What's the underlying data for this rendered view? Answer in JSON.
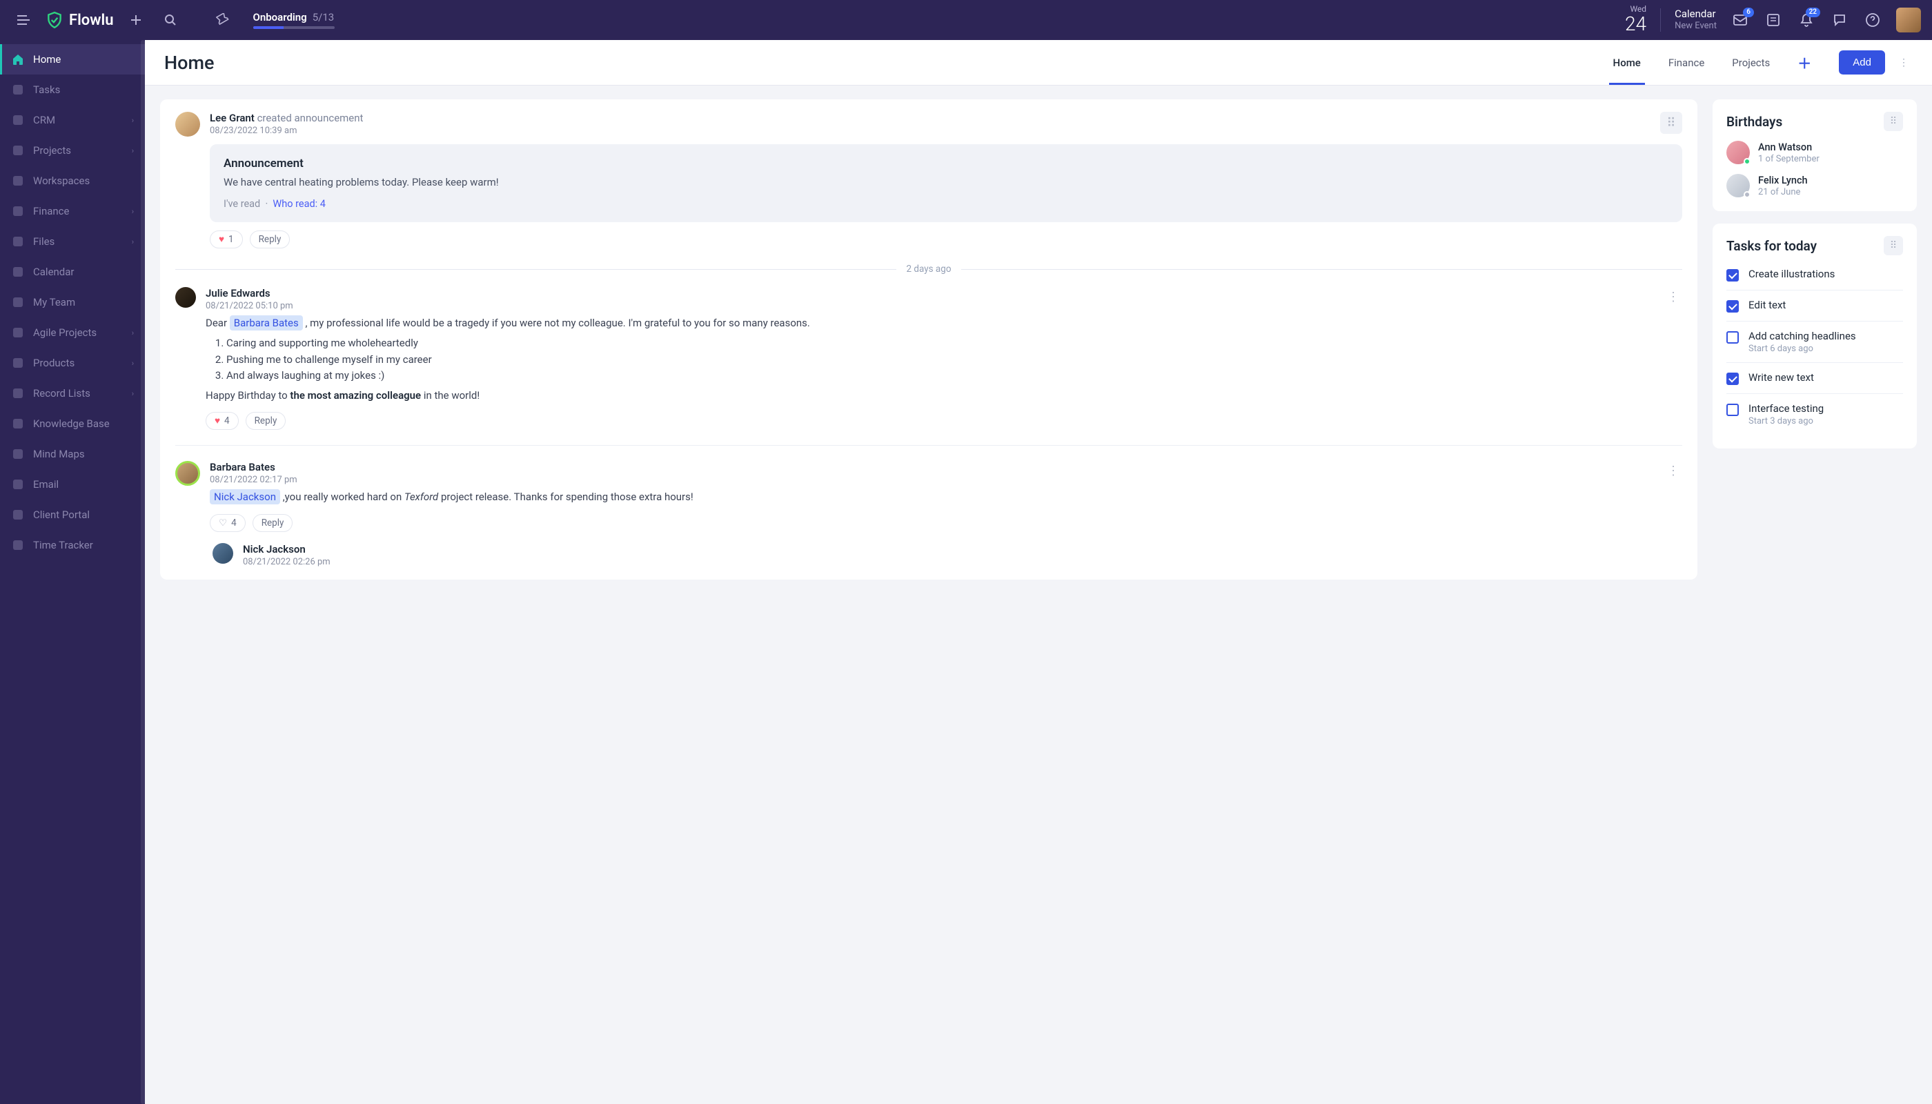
{
  "brand": "Flowlu",
  "onboarding": {
    "label": "Onboarding",
    "count": "5/13",
    "progress_pct": 38
  },
  "topbar": {
    "date": {
      "dow": "Wed",
      "day": "24"
    },
    "calendar": {
      "title": "Calendar",
      "sub": "New Event"
    },
    "badges": {
      "inbox": "6",
      "bell": "22"
    }
  },
  "sidebar": {
    "items": [
      {
        "label": "Home",
        "icon": "home",
        "active": true
      },
      {
        "label": "Tasks",
        "icon": "check"
      },
      {
        "label": "CRM",
        "icon": "funnel",
        "chev": true
      },
      {
        "label": "Projects",
        "icon": "briefcase",
        "chev": true
      },
      {
        "label": "Workspaces",
        "icon": "grid"
      },
      {
        "label": "Finance",
        "icon": "graph",
        "chev": true
      },
      {
        "label": "Files",
        "icon": "folder",
        "chev": true
      },
      {
        "label": "Calendar",
        "icon": "calendar"
      },
      {
        "label": "My Team",
        "icon": "users"
      },
      {
        "label": "Agile Projects",
        "icon": "agile",
        "chev": true
      },
      {
        "label": "Products",
        "icon": "box",
        "chev": true
      },
      {
        "label": "Record Lists",
        "icon": "list",
        "chev": true
      },
      {
        "label": "Knowledge Base",
        "icon": "book"
      },
      {
        "label": "Mind Maps",
        "icon": "mindmap"
      },
      {
        "label": "Email",
        "icon": "mail"
      },
      {
        "label": "Client Portal",
        "icon": "portal"
      },
      {
        "label": "Time Tracker",
        "icon": "clock"
      }
    ]
  },
  "page": {
    "title": "Home",
    "tabs": [
      "Home",
      "Finance",
      "Projects"
    ],
    "add_label": "Add"
  },
  "feed": {
    "divider": "2 days ago",
    "posts": [
      {
        "author": "Lee Grant",
        "action": "created announcement",
        "time": "08/23/2022 10:39 am",
        "announcement": {
          "title": "Announcement",
          "body": "We have central heating problems today. Please keep warm!",
          "read_label": "I've read",
          "who_read": "Who read: 4"
        },
        "likes": "1",
        "reply": "Reply"
      },
      {
        "author": "Julie Edwards",
        "time": "08/21/2022 05:10 pm",
        "rich": {
          "pre": "Dear ",
          "mention": "Barbara Bates",
          "post": " , my professional life would be a tragedy if you were not my colleague. I'm grateful to you for so many reasons.",
          "list": [
            "Caring and supporting me wholeheartedly",
            "Pushing me to challenge myself in my career",
            "And always laughing at my jokes :)"
          ],
          "closing_pre": "Happy Birthday to ",
          "closing_bold": "the most amazing colleague",
          "closing_post": " in the world!"
        },
        "likes": "4",
        "reply": "Reply"
      },
      {
        "author": "Barbara Bates",
        "time": "08/21/2022 02:17 pm",
        "rich2": {
          "mention": "Nick Jackson",
          "post_a": " ,you really worked hard on ",
          "italic": "Texford",
          "post_b": " project release. Thanks for spending those extra hours!"
        },
        "likes": "4",
        "reply": "Reply",
        "nested": {
          "author": "Nick Jackson",
          "time": "08/21/2022 02:26 pm"
        }
      }
    ]
  },
  "birthdays": {
    "title": "Birthdays",
    "items": [
      {
        "name": "Ann Watson",
        "date": "1 of September",
        "status": "online"
      },
      {
        "name": "Felix Lynch",
        "date": "21 of June",
        "status": "offline"
      }
    ]
  },
  "tasks": {
    "title": "Tasks for today",
    "items": [
      {
        "label": "Create illustrations",
        "checked": true
      },
      {
        "label": "Edit text",
        "checked": true
      },
      {
        "label": "Add catching headlines",
        "checked": false,
        "sub": "Start 6 days ago"
      },
      {
        "label": "Write new text",
        "checked": true
      },
      {
        "label": "Interface testing",
        "checked": false,
        "sub": "Start 3 days ago"
      }
    ]
  }
}
